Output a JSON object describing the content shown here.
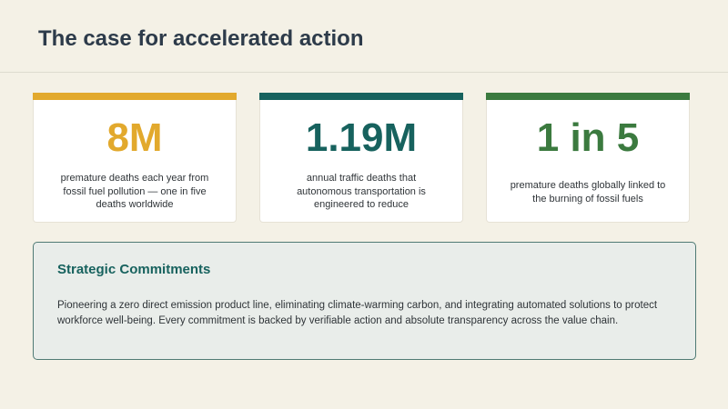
{
  "page": {
    "title": "The case for accelerated action"
  },
  "stats": [
    {
      "value": "8M",
      "description": "premature deaths each year from fossil fuel pollution — one in five deaths worldwide",
      "accent_color": "#e2a92d"
    },
    {
      "value": "1.19M",
      "description": "annual traffic deaths that autonomous transportation is engineered to reduce",
      "accent_color": "#17625e"
    },
    {
      "value": "1 in 5",
      "description": "premature deaths globally linked to the burning of fossil fuels",
      "accent_color": "#3b7a3f"
    }
  ],
  "commitments": {
    "heading": "Strategic Commitments",
    "heading_color": "#17625e",
    "body": "Pioneering a zero direct emission product line, eliminating climate-warming carbon, and integrating automated solutions to protect workforce well-being. Every commitment is backed by verifiable action and absolute transparency across the value chain."
  }
}
